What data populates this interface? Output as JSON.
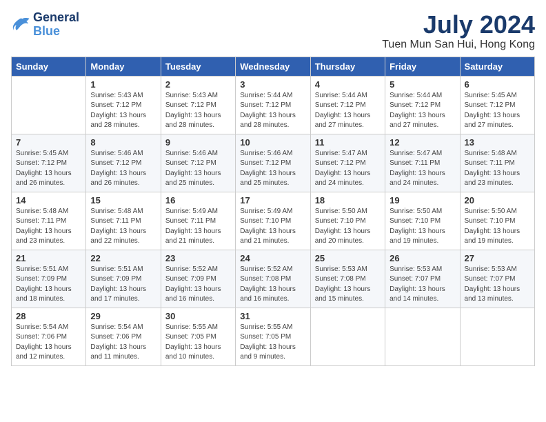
{
  "header": {
    "logo_line1": "General",
    "logo_line2": "Blue",
    "month": "July 2024",
    "location": "Tuen Mun San Hui, Hong Kong"
  },
  "weekdays": [
    "Sunday",
    "Monday",
    "Tuesday",
    "Wednesday",
    "Thursday",
    "Friday",
    "Saturday"
  ],
  "weeks": [
    [
      {
        "day": "",
        "info": ""
      },
      {
        "day": "1",
        "info": "Sunrise: 5:43 AM\nSunset: 7:12 PM\nDaylight: 13 hours\nand 28 minutes."
      },
      {
        "day": "2",
        "info": "Sunrise: 5:43 AM\nSunset: 7:12 PM\nDaylight: 13 hours\nand 28 minutes."
      },
      {
        "day": "3",
        "info": "Sunrise: 5:44 AM\nSunset: 7:12 PM\nDaylight: 13 hours\nand 28 minutes."
      },
      {
        "day": "4",
        "info": "Sunrise: 5:44 AM\nSunset: 7:12 PM\nDaylight: 13 hours\nand 27 minutes."
      },
      {
        "day": "5",
        "info": "Sunrise: 5:44 AM\nSunset: 7:12 PM\nDaylight: 13 hours\nand 27 minutes."
      },
      {
        "day": "6",
        "info": "Sunrise: 5:45 AM\nSunset: 7:12 PM\nDaylight: 13 hours\nand 27 minutes."
      }
    ],
    [
      {
        "day": "7",
        "info": "Sunrise: 5:45 AM\nSunset: 7:12 PM\nDaylight: 13 hours\nand 26 minutes."
      },
      {
        "day": "8",
        "info": "Sunrise: 5:46 AM\nSunset: 7:12 PM\nDaylight: 13 hours\nand 26 minutes."
      },
      {
        "day": "9",
        "info": "Sunrise: 5:46 AM\nSunset: 7:12 PM\nDaylight: 13 hours\nand 25 minutes."
      },
      {
        "day": "10",
        "info": "Sunrise: 5:46 AM\nSunset: 7:12 PM\nDaylight: 13 hours\nand 25 minutes."
      },
      {
        "day": "11",
        "info": "Sunrise: 5:47 AM\nSunset: 7:12 PM\nDaylight: 13 hours\nand 24 minutes."
      },
      {
        "day": "12",
        "info": "Sunrise: 5:47 AM\nSunset: 7:11 PM\nDaylight: 13 hours\nand 24 minutes."
      },
      {
        "day": "13",
        "info": "Sunrise: 5:48 AM\nSunset: 7:11 PM\nDaylight: 13 hours\nand 23 minutes."
      }
    ],
    [
      {
        "day": "14",
        "info": "Sunrise: 5:48 AM\nSunset: 7:11 PM\nDaylight: 13 hours\nand 23 minutes."
      },
      {
        "day": "15",
        "info": "Sunrise: 5:48 AM\nSunset: 7:11 PM\nDaylight: 13 hours\nand 22 minutes."
      },
      {
        "day": "16",
        "info": "Sunrise: 5:49 AM\nSunset: 7:11 PM\nDaylight: 13 hours\nand 21 minutes."
      },
      {
        "day": "17",
        "info": "Sunrise: 5:49 AM\nSunset: 7:10 PM\nDaylight: 13 hours\nand 21 minutes."
      },
      {
        "day": "18",
        "info": "Sunrise: 5:50 AM\nSunset: 7:10 PM\nDaylight: 13 hours\nand 20 minutes."
      },
      {
        "day": "19",
        "info": "Sunrise: 5:50 AM\nSunset: 7:10 PM\nDaylight: 13 hours\nand 19 minutes."
      },
      {
        "day": "20",
        "info": "Sunrise: 5:50 AM\nSunset: 7:10 PM\nDaylight: 13 hours\nand 19 minutes."
      }
    ],
    [
      {
        "day": "21",
        "info": "Sunrise: 5:51 AM\nSunset: 7:09 PM\nDaylight: 13 hours\nand 18 minutes."
      },
      {
        "day": "22",
        "info": "Sunrise: 5:51 AM\nSunset: 7:09 PM\nDaylight: 13 hours\nand 17 minutes."
      },
      {
        "day": "23",
        "info": "Sunrise: 5:52 AM\nSunset: 7:09 PM\nDaylight: 13 hours\nand 16 minutes."
      },
      {
        "day": "24",
        "info": "Sunrise: 5:52 AM\nSunset: 7:08 PM\nDaylight: 13 hours\nand 16 minutes."
      },
      {
        "day": "25",
        "info": "Sunrise: 5:53 AM\nSunset: 7:08 PM\nDaylight: 13 hours\nand 15 minutes."
      },
      {
        "day": "26",
        "info": "Sunrise: 5:53 AM\nSunset: 7:07 PM\nDaylight: 13 hours\nand 14 minutes."
      },
      {
        "day": "27",
        "info": "Sunrise: 5:53 AM\nSunset: 7:07 PM\nDaylight: 13 hours\nand 13 minutes."
      }
    ],
    [
      {
        "day": "28",
        "info": "Sunrise: 5:54 AM\nSunset: 7:06 PM\nDaylight: 13 hours\nand 12 minutes."
      },
      {
        "day": "29",
        "info": "Sunrise: 5:54 AM\nSunset: 7:06 PM\nDaylight: 13 hours\nand 11 minutes."
      },
      {
        "day": "30",
        "info": "Sunrise: 5:55 AM\nSunset: 7:05 PM\nDaylight: 13 hours\nand 10 minutes."
      },
      {
        "day": "31",
        "info": "Sunrise: 5:55 AM\nSunset: 7:05 PM\nDaylight: 13 hours\nand 9 minutes."
      },
      {
        "day": "",
        "info": ""
      },
      {
        "day": "",
        "info": ""
      },
      {
        "day": "",
        "info": ""
      }
    ]
  ]
}
